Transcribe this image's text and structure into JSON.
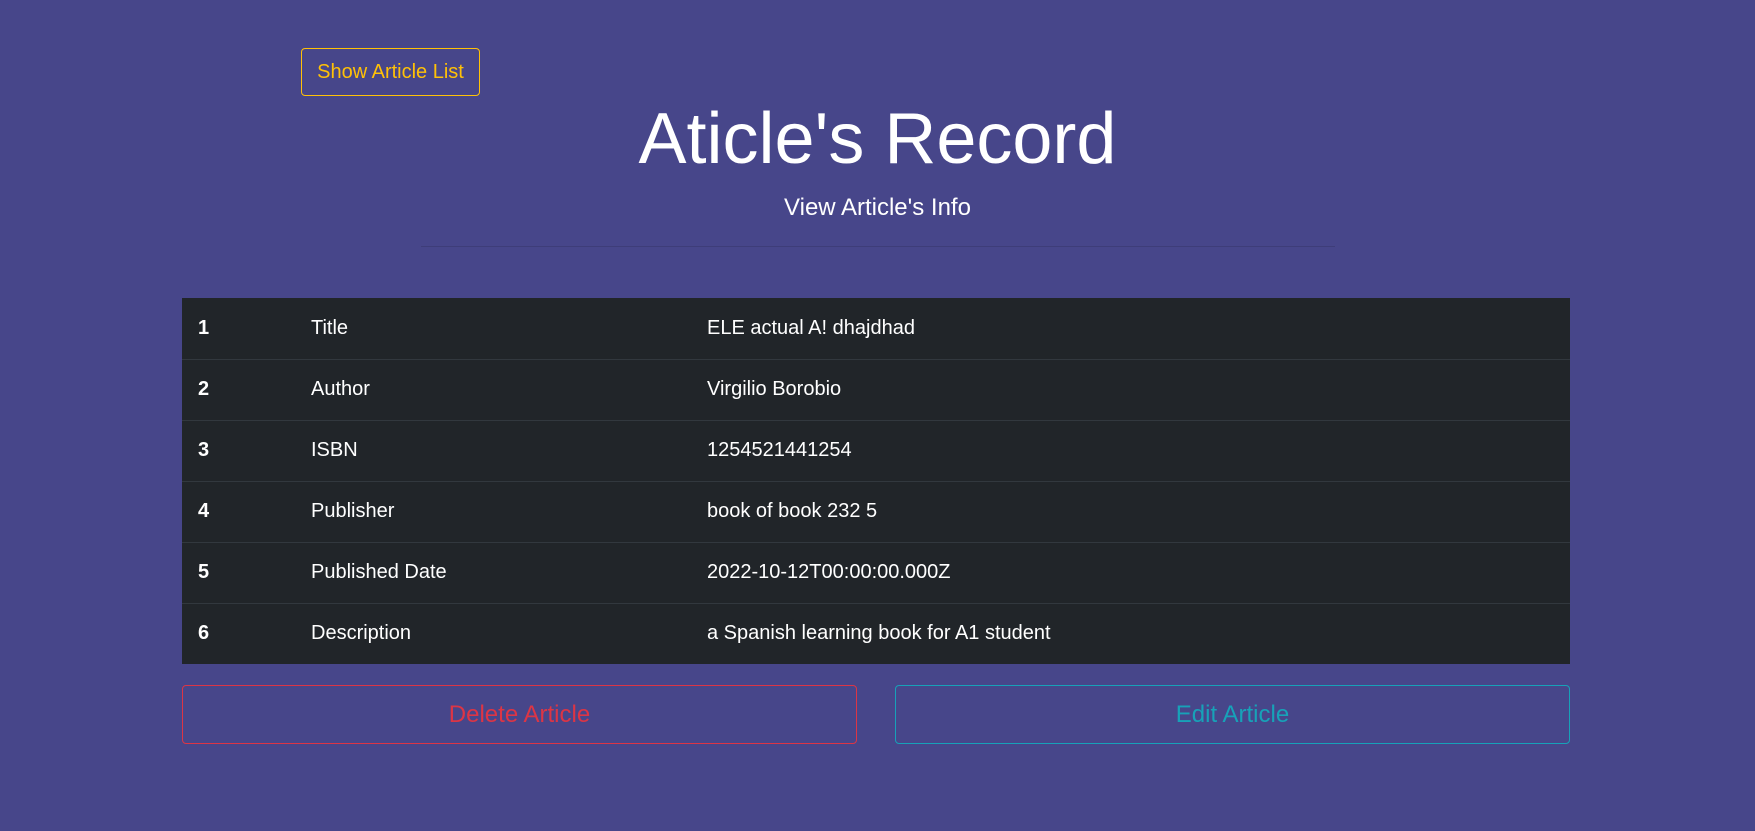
{
  "header": {
    "show_list_label": "Show Article List",
    "title": "Aticle's Record",
    "subtitle": "View Article's Info"
  },
  "record": {
    "rows": [
      {
        "num": "1",
        "label": "Title",
        "value": "ELE actual A! dhajdhad"
      },
      {
        "num": "2",
        "label": "Author",
        "value": "Virgilio Borobio"
      },
      {
        "num": "3",
        "label": "ISBN",
        "value": "1254521441254"
      },
      {
        "num": "4",
        "label": "Publisher",
        "value": "book of book 232 5"
      },
      {
        "num": "5",
        "label": "Published Date",
        "value": "2022-10-12T00:00:00.000Z"
      },
      {
        "num": "6",
        "label": "Description",
        "value": "a Spanish learning book for A1 student"
      }
    ]
  },
  "actions": {
    "delete_label": "Delete Article",
    "edit_label": "Edit Article"
  },
  "colors": {
    "background": "#47468a",
    "table_bg": "#212529",
    "warning": "#ffc107",
    "danger": "#dc3545",
    "info": "#17a2b8"
  }
}
